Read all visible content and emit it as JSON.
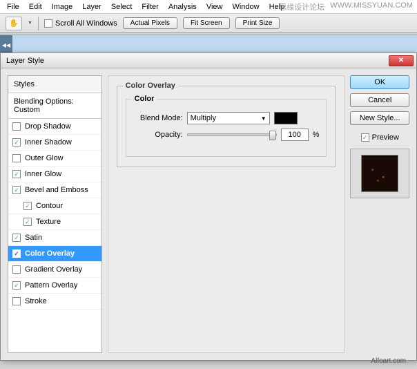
{
  "menu": [
    "File",
    "Edit",
    "Image",
    "Layer",
    "Select",
    "Filter",
    "Analysis",
    "View",
    "Window",
    "Help"
  ],
  "watermark": {
    "a": "思缘设计论坛",
    "b": "WWW.MISSYUAN.COM"
  },
  "toolbar": {
    "scroll_all": "Scroll All Windows",
    "actual": "Actual Pixels",
    "fit": "Fit Screen",
    "print": "Print Size"
  },
  "dialog": {
    "title": "Layer Style",
    "styles_header": "Styles",
    "blending": "Blending Options: Custom",
    "items": [
      {
        "label": "Drop Shadow",
        "checked": false,
        "indent": false
      },
      {
        "label": "Inner Shadow",
        "checked": true,
        "indent": false
      },
      {
        "label": "Outer Glow",
        "checked": false,
        "indent": false
      },
      {
        "label": "Inner Glow",
        "checked": true,
        "indent": false
      },
      {
        "label": "Bevel and Emboss",
        "checked": true,
        "indent": false
      },
      {
        "label": "Contour",
        "checked": true,
        "indent": true
      },
      {
        "label": "Texture",
        "checked": true,
        "indent": true
      },
      {
        "label": "Satin",
        "checked": true,
        "indent": false
      },
      {
        "label": "Color Overlay",
        "checked": true,
        "indent": false,
        "selected": true
      },
      {
        "label": "Gradient Overlay",
        "checked": false,
        "indent": false
      },
      {
        "label": "Pattern Overlay",
        "checked": true,
        "indent": false
      },
      {
        "label": "Stroke",
        "checked": false,
        "indent": false
      }
    ],
    "panel_title": "Color Overlay",
    "group_title": "Color",
    "blend_label": "Blend Mode:",
    "blend_value": "Multiply",
    "opacity_label": "Opacity:",
    "opacity_value": "100",
    "opacity_unit": "%",
    "swatch_color": "#000000",
    "ok": "OK",
    "cancel": "Cancel",
    "new_style": "New Style...",
    "preview": "Preview"
  },
  "footer": "Alfoart.com"
}
